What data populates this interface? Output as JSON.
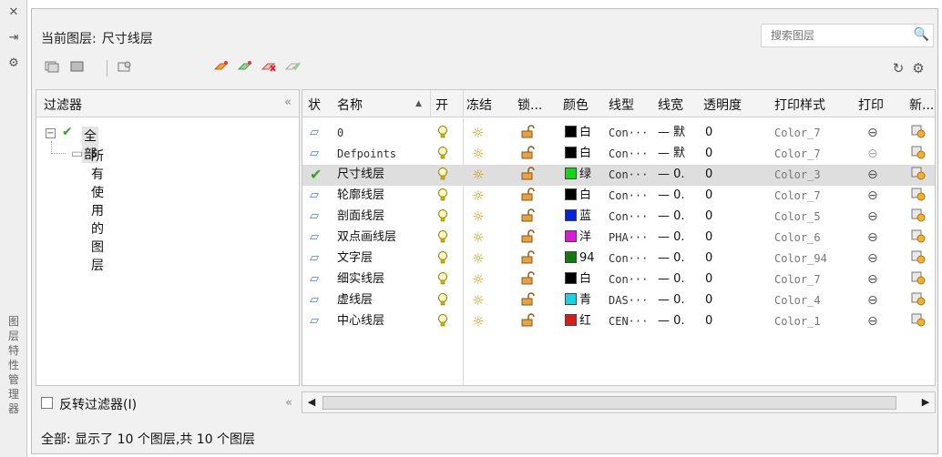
{
  "side_strip": {
    "close_glyph": "✕",
    "pin_glyph": "⇥",
    "settings_glyph": "⚙",
    "title": "图层特性管理器"
  },
  "header": {
    "current_layer_label": "当前图层:",
    "current_layer_value": "尺寸线层"
  },
  "search": {
    "placeholder": "搜索图层"
  },
  "filter_panel": {
    "title": "过滤器",
    "collapse_glyph": "«",
    "tree": {
      "root": "全部",
      "child": "所有使用的图层"
    },
    "invert_label": "反转过滤器(I)"
  },
  "table": {
    "headers": {
      "status": "状",
      "name": "名称",
      "on": "开",
      "freeze": "冻结",
      "lock": "锁...",
      "color": "颜色",
      "linetype": "线型",
      "lineweight": "线宽",
      "transparency": "透明度",
      "plot_style": "打印样式",
      "plot": "打印",
      "new_vp": "新..."
    },
    "rows": [
      {
        "name": "0",
        "color_hex": "#000000",
        "color_name": "白",
        "linetype": "Con···",
        "lineweight": "— 默",
        "transparency": "0",
        "plot_style": "Color_7",
        "plot_enabled": true
      },
      {
        "name": "Defpoints",
        "color_hex": "#000000",
        "color_name": "白",
        "linetype": "Con···",
        "lineweight": "— 默",
        "transparency": "0",
        "plot_style": "Color_7",
        "plot_enabled": false
      },
      {
        "name": "尺寸线层",
        "color_hex": "#19d21b",
        "color_name": "绿",
        "linetype": "Con···",
        "lineweight": "— 0.",
        "transparency": "0",
        "plot_style": "Color_3",
        "plot_enabled": true,
        "current": true
      },
      {
        "name": "轮廓线层",
        "color_hex": "#000000",
        "color_name": "白",
        "linetype": "Con···",
        "lineweight": "— 0.",
        "transparency": "0",
        "plot_style": "Color_7",
        "plot_enabled": true
      },
      {
        "name": "剖面线层",
        "color_hex": "#0a22d8",
        "color_name": "蓝",
        "linetype": "Con···",
        "lineweight": "— 0.",
        "transparency": "0",
        "plot_style": "Color_5",
        "plot_enabled": true
      },
      {
        "name": "双点画线层",
        "color_hex": "#d91ad9",
        "color_name": "洋",
        "linetype": "PHA···",
        "lineweight": "— 0.",
        "transparency": "0",
        "plot_style": "Color_6",
        "plot_enabled": true
      },
      {
        "name": "文字层",
        "color_hex": "#117a11",
        "color_name": "94",
        "linetype": "Con···",
        "lineweight": "— 0.",
        "transparency": "0",
        "plot_style": "Color_94",
        "plot_enabled": true
      },
      {
        "name": "细实线层",
        "color_hex": "#000000",
        "color_name": "白",
        "linetype": "Con···",
        "lineweight": "— 0.",
        "transparency": "0",
        "plot_style": "Color_7",
        "plot_enabled": true
      },
      {
        "name": "虚线层",
        "color_hex": "#1ad2e0",
        "color_name": "青",
        "linetype": "DAS···",
        "lineweight": "— 0.",
        "transparency": "0",
        "plot_style": "Color_4",
        "plot_enabled": true
      },
      {
        "name": "中心线层",
        "color_hex": "#d81b1b",
        "color_name": "红",
        "linetype": "CEN···",
        "lineweight": "— 0.",
        "transparency": "0",
        "plot_style": "Color_1",
        "plot_enabled": true
      }
    ]
  },
  "scrollbar": {
    "left_glyph": "◀",
    "right_glyph": "▶"
  },
  "status_bar": {
    "text": "全部: 显示了 10 个图层,共 10 个图层"
  },
  "icons": {
    "bulb": "💡",
    "sun": "☼",
    "lock": "🔓",
    "layer": "▱",
    "check": "✔",
    "printer": "⊖",
    "new_vp": "▣",
    "search": "🔍",
    "refresh": "↻",
    "gear": "⚙"
  }
}
